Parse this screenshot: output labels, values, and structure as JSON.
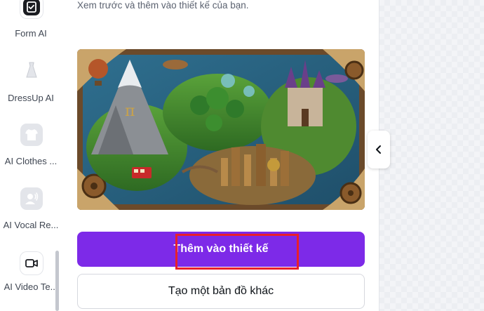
{
  "rail": {
    "items": [
      {
        "label": "Form AI",
        "icon": "form-icon"
      },
      {
        "label": "DressUp AI",
        "icon": "dress-icon"
      },
      {
        "label": "AI Clothes ...",
        "icon": "shirt-icon"
      },
      {
        "label": "AI Vocal Re...",
        "icon": "person-voice-icon"
      },
      {
        "label": "AI Video Te...",
        "icon": "video-camera-icon"
      }
    ]
  },
  "panel": {
    "subtitle": "Xem trước và thêm vào thiết kế của bạn.",
    "primary_button": "Thêm vào thiết kế",
    "secondary_button": "Tạo một bản đồ khác"
  },
  "colors": {
    "accent": "#7d2ae8",
    "highlight": "#e8202a"
  }
}
